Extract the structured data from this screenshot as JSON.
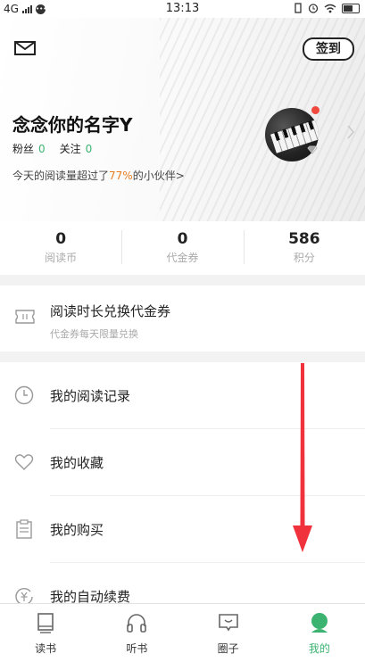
{
  "status_bar": {
    "network": "4G",
    "time": "13:13"
  },
  "header": {
    "signin_label": "签到"
  },
  "profile": {
    "name": "念念你的名字Y",
    "fans_label": "粉丝",
    "fans_count": "0",
    "follow_label": "关注",
    "follow_count": "0",
    "read_prefix": "今天的阅读量超过了",
    "read_percent": "77%",
    "read_suffix": "的小伙伴>"
  },
  "stats": [
    {
      "value": "0",
      "label": "阅读币"
    },
    {
      "value": "0",
      "label": "代金券"
    },
    {
      "value": "586",
      "label": "积分"
    }
  ],
  "exchange": {
    "title": "阅读时长兑换代金券",
    "subtitle": "代金券每天限量兑换"
  },
  "menu": {
    "items": [
      {
        "label": "我的阅读记录",
        "icon": "clock-icon"
      },
      {
        "label": "我的收藏",
        "icon": "heart-icon"
      },
      {
        "label": "我的购买",
        "icon": "clipboard-icon"
      },
      {
        "label": "我的自动续费",
        "icon": "yuan-cycle-icon"
      }
    ]
  },
  "tabs": [
    {
      "label": "读书",
      "icon": "book-icon"
    },
    {
      "label": "听书",
      "icon": "headphones-icon"
    },
    {
      "label": "圈子",
      "icon": "chat-icon"
    },
    {
      "label": "我的",
      "icon": "profile-icon"
    }
  ],
  "colors": {
    "accent": "#3cb371",
    "highlight": "#e67e22",
    "arrow": "#f0323c",
    "badge": "#f04a3e"
  }
}
